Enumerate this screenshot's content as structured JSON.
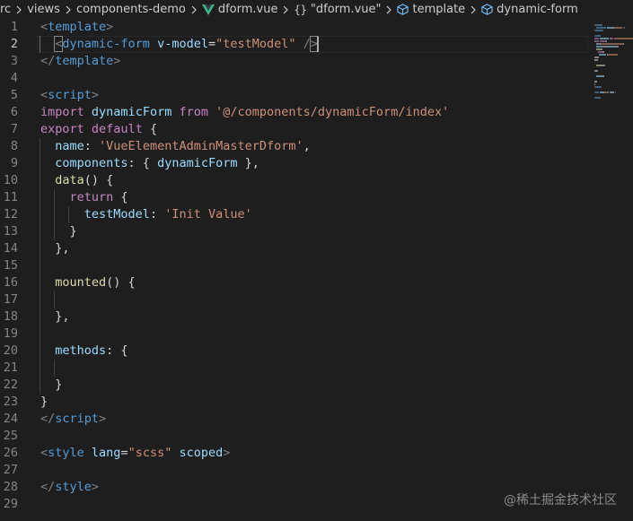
{
  "breadcrumb": {
    "items": [
      {
        "label": "rc"
      },
      {
        "label": "views"
      },
      {
        "label": "components-demo"
      },
      {
        "label": "dform.vue",
        "icon": "vue-icon"
      },
      {
        "label": "\"dform.vue\"",
        "icon": "braces-icon",
        "icon_text": "{}"
      },
      {
        "label": "template",
        "icon": "cube-icon"
      },
      {
        "label": "dynamic-form",
        "icon": "cube-icon"
      }
    ]
  },
  "editor": {
    "current_line": 2,
    "lines": [
      {
        "n": "1"
      },
      {
        "n": "2"
      },
      {
        "n": "3"
      },
      {
        "n": "4"
      },
      {
        "n": "5"
      },
      {
        "n": "6"
      },
      {
        "n": "7"
      },
      {
        "n": "8"
      },
      {
        "n": "9"
      },
      {
        "n": "10"
      },
      {
        "n": "11"
      },
      {
        "n": "12"
      },
      {
        "n": "13"
      },
      {
        "n": "14"
      },
      {
        "n": "15"
      },
      {
        "n": "16"
      },
      {
        "n": "17"
      },
      {
        "n": "18"
      },
      {
        "n": "19"
      },
      {
        "n": "20"
      },
      {
        "n": "21"
      },
      {
        "n": "22"
      },
      {
        "n": "23"
      },
      {
        "n": "24"
      },
      {
        "n": "25"
      },
      {
        "n": "26"
      },
      {
        "n": "27"
      },
      {
        "n": "28"
      },
      {
        "n": "29"
      }
    ],
    "code": [
      [
        {
          "t": "<",
          "c": "punc"
        },
        {
          "t": "template",
          "c": "tag"
        },
        {
          "t": ">",
          "c": "punc"
        }
      ],
      [
        {
          "t": "  ",
          "c": "plain"
        },
        {
          "t": "<",
          "c": "punc",
          "bracket": true
        },
        {
          "t": "dynamic-form",
          "c": "tag"
        },
        {
          "t": " ",
          "c": "plain"
        },
        {
          "t": "v-model",
          "c": "attr"
        },
        {
          "t": "=",
          "c": "plain"
        },
        {
          "t": "\"testModel\"",
          "c": "str"
        },
        {
          "t": " ",
          "c": "plain"
        },
        {
          "t": "/",
          "c": "punc"
        },
        {
          "t": ">",
          "c": "punc",
          "bracket": true
        }
      ],
      [
        {
          "t": "</",
          "c": "punc"
        },
        {
          "t": "template",
          "c": "tag"
        },
        {
          "t": ">",
          "c": "punc"
        }
      ],
      [],
      [
        {
          "t": "<",
          "c": "punc"
        },
        {
          "t": "script",
          "c": "tag"
        },
        {
          "t": ">",
          "c": "punc"
        }
      ],
      [
        {
          "t": "import",
          "c": "kw"
        },
        {
          "t": " ",
          "c": "plain"
        },
        {
          "t": "dynamicForm",
          "c": "var"
        },
        {
          "t": " ",
          "c": "plain"
        },
        {
          "t": "from",
          "c": "kw"
        },
        {
          "t": " ",
          "c": "plain"
        },
        {
          "t": "'@/components/dynamicForm/index'",
          "c": "str"
        }
      ],
      [
        {
          "t": "export",
          "c": "kw"
        },
        {
          "t": " ",
          "c": "plain"
        },
        {
          "t": "default",
          "c": "kw"
        },
        {
          "t": " {",
          "c": "plain"
        }
      ],
      [
        {
          "t": "  ",
          "c": "plain"
        },
        {
          "t": "name",
          "c": "var"
        },
        {
          "t": ": ",
          "c": "plain"
        },
        {
          "t": "'VueElementAdminMasterDform'",
          "c": "str"
        },
        {
          "t": ",",
          "c": "plain"
        }
      ],
      [
        {
          "t": "  ",
          "c": "plain"
        },
        {
          "t": "components",
          "c": "var"
        },
        {
          "t": ": { ",
          "c": "plain"
        },
        {
          "t": "dynamicForm",
          "c": "var"
        },
        {
          "t": " },",
          "c": "plain"
        }
      ],
      [
        {
          "t": "  ",
          "c": "plain"
        },
        {
          "t": "data",
          "c": "fn"
        },
        {
          "t": "() {",
          "c": "plain"
        }
      ],
      [
        {
          "t": "    ",
          "c": "plain"
        },
        {
          "t": "return",
          "c": "kw"
        },
        {
          "t": " {",
          "c": "plain"
        }
      ],
      [
        {
          "t": "      ",
          "c": "plain"
        },
        {
          "t": "testModel",
          "c": "var"
        },
        {
          "t": ": ",
          "c": "plain"
        },
        {
          "t": "'Init Value'",
          "c": "str"
        }
      ],
      [
        {
          "t": "    }",
          "c": "plain"
        }
      ],
      [
        {
          "t": "  },",
          "c": "plain"
        }
      ],
      [],
      [
        {
          "t": "  ",
          "c": "plain"
        },
        {
          "t": "mounted",
          "c": "fn"
        },
        {
          "t": "() {",
          "c": "plain"
        }
      ],
      [],
      [
        {
          "t": "  },",
          "c": "plain"
        }
      ],
      [],
      [
        {
          "t": "  ",
          "c": "plain"
        },
        {
          "t": "methods",
          "c": "var"
        },
        {
          "t": ": {",
          "c": "plain"
        }
      ],
      [],
      [
        {
          "t": "  }",
          "c": "plain"
        }
      ],
      [
        {
          "t": "}",
          "c": "plain"
        }
      ],
      [
        {
          "t": "</",
          "c": "punc"
        },
        {
          "t": "script",
          "c": "tag"
        },
        {
          "t": ">",
          "c": "punc"
        }
      ],
      [],
      [
        {
          "t": "<",
          "c": "punc"
        },
        {
          "t": "style",
          "c": "tag"
        },
        {
          "t": " ",
          "c": "plain"
        },
        {
          "t": "lang",
          "c": "attr"
        },
        {
          "t": "=",
          "c": "plain"
        },
        {
          "t": "\"scss\"",
          "c": "str"
        },
        {
          "t": " ",
          "c": "plain"
        },
        {
          "t": "scoped",
          "c": "attr"
        },
        {
          "t": ">",
          "c": "punc"
        }
      ],
      [],
      [
        {
          "t": "</",
          "c": "punc"
        },
        {
          "t": "style",
          "c": "tag"
        },
        {
          "t": ">",
          "c": "punc"
        }
      ],
      []
    ]
  },
  "colors": {
    "background": "#1e1e1e",
    "line_number": "#858585",
    "line_number_active": "#c6c6c6",
    "tag": "#569cd6",
    "punctuation": "#808080",
    "attribute": "#9cdcfe",
    "string": "#ce9178",
    "keyword": "#c586c0",
    "variable": "#9cdcfe",
    "function": "#dcdcaa",
    "text": "#d4d4d4",
    "vue_green": "#41b883"
  },
  "watermark": {
    "text": "@稀土掘金技术社区"
  }
}
